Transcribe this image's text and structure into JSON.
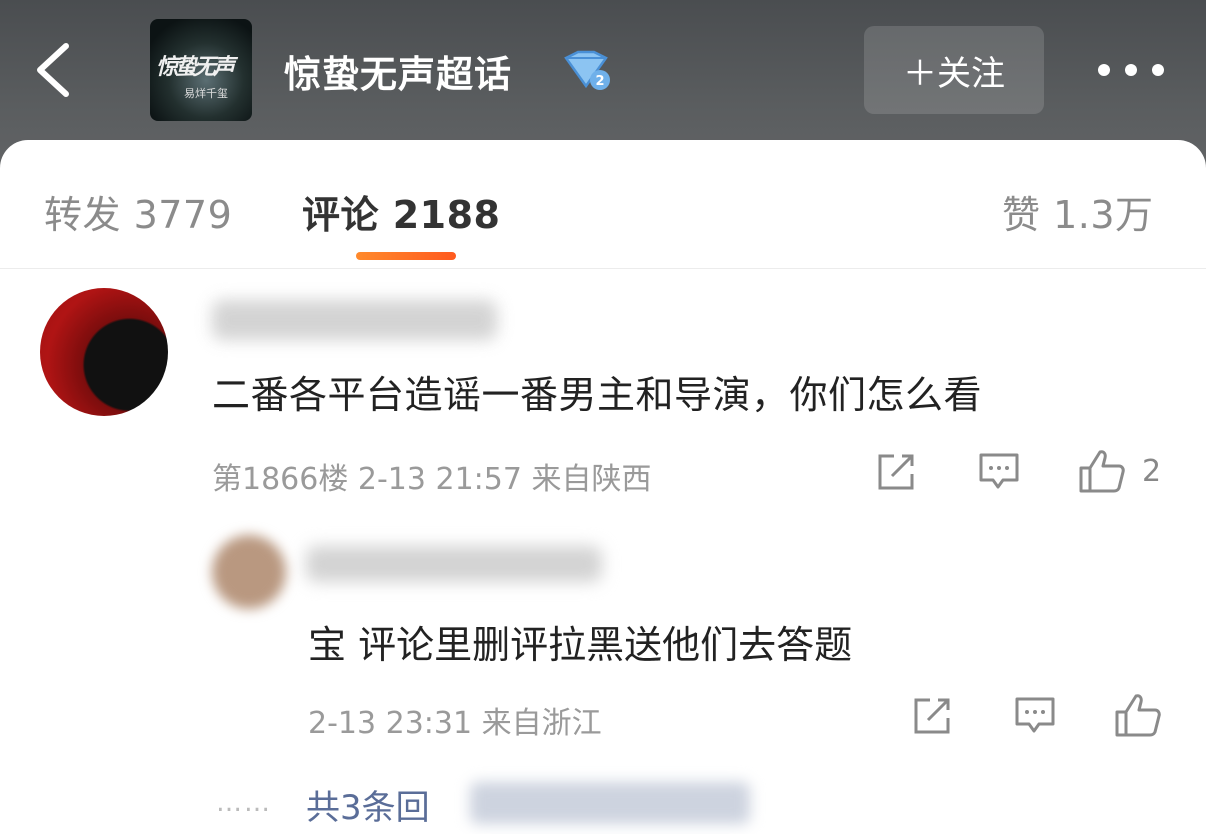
{
  "header": {
    "back_icon": "chevron-left-icon",
    "cover_title": "惊蛰无声",
    "cover_subtitle": "易烊千玺",
    "topic_title": "惊蛰无声超话",
    "badge_icon": "diamond-level-2-icon",
    "follow_label": "＋关注",
    "more_icon": "more-dots-icon"
  },
  "tabs": {
    "repost": "转发 3779",
    "comments": "评论 2188",
    "likes": "赞 1.3万"
  },
  "comment": {
    "text": "二番各平台造谣一番男主和导演，你们怎么看",
    "meta": "第1866楼 2-13 21:57 来自陕西",
    "like_count": "2",
    "icons": [
      "share-icon",
      "reply-icon",
      "like-icon"
    ]
  },
  "reply": {
    "text": "宝 评论里删评拉黑送他们去答题",
    "meta": "2-13 23:31 来自浙江"
  },
  "more_replies": {
    "dots": "……",
    "label": "共3条回"
  },
  "colors": {
    "header_bg": "#55585a",
    "accent": "#ff6a1f",
    "link": "#5a6d98"
  }
}
